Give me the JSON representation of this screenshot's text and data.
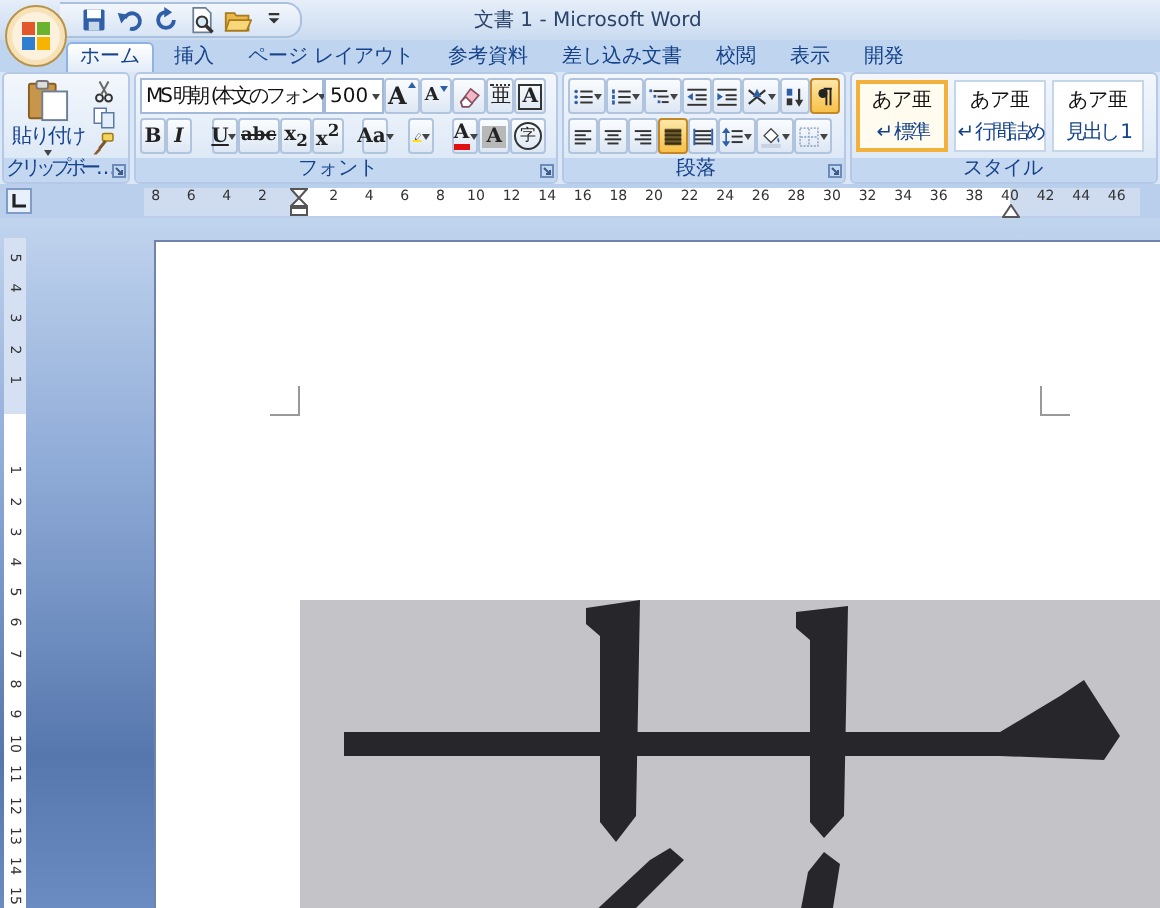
{
  "window": {
    "title": "文書 1 - Microsoft Word"
  },
  "quick_access": [
    {
      "kind": "save"
    },
    {
      "kind": "undo"
    },
    {
      "kind": "redo"
    },
    {
      "kind": "preview"
    },
    {
      "kind": "open"
    },
    {
      "kind": "customize"
    }
  ],
  "tabs": [
    {
      "label": "ホーム",
      "selected": true
    },
    {
      "label": "挿入",
      "selected": false
    },
    {
      "label": "ページ レイアウト",
      "selected": false
    },
    {
      "label": "参考資料",
      "selected": false
    },
    {
      "label": "差し込み文書",
      "selected": false
    },
    {
      "label": "校閲",
      "selected": false
    },
    {
      "label": "表示",
      "selected": false
    },
    {
      "label": "開発",
      "selected": false
    }
  ],
  "ribbon": {
    "clipboard": {
      "label": "クリップボー…",
      "paste": "貼り付け",
      "tools": [
        {
          "kind": "cut"
        },
        {
          "kind": "copy"
        },
        {
          "kind": "painter"
        }
      ]
    },
    "font": {
      "label": "フォント",
      "font_name": "MS 明朝 (本文のフォン",
      "font_size": "500",
      "top_buttons": [
        {
          "kind": "grow",
          "label": "A"
        },
        {
          "kind": "shrink",
          "label": "A"
        },
        {
          "kind": "clear"
        },
        {
          "kind": "ruby",
          "label": "亜"
        },
        {
          "kind": "border",
          "label": "A"
        }
      ],
      "bottom_buttons": [
        {
          "kind": "bold",
          "label": "B"
        },
        {
          "kind": "italic",
          "label": "I"
        },
        {
          "kind": "underline",
          "label": "U"
        },
        {
          "kind": "strike",
          "label": "abc"
        },
        {
          "kind": "sub",
          "label": "x$_{2}$"
        },
        {
          "kind": "sup",
          "label": "x$^{2}$"
        },
        {
          "kind": "case",
          "label": "Aa"
        },
        {
          "kind": "highlight"
        },
        {
          "kind": "color",
          "label": "A"
        },
        {
          "kind": "shading",
          "label": "A"
        },
        {
          "kind": "enclosed",
          "label": "字"
        }
      ]
    },
    "paragraph": {
      "label": "段落",
      "top_buttons": [
        {
          "kind": "bullets",
          "on": false
        },
        {
          "kind": "numbering",
          "on": false
        },
        {
          "kind": "multilevel",
          "on": false
        },
        {
          "kind": "outdent",
          "on": false
        },
        {
          "kind": "indent",
          "on": false
        },
        {
          "kind": "asian",
          "on": false
        },
        {
          "kind": "sort",
          "on": false
        },
        {
          "kind": "marks",
          "on": true
        }
      ],
      "bottom_buttons": [
        {
          "kind": "align_left",
          "on": false
        },
        {
          "kind": "center",
          "on": false
        },
        {
          "kind": "align_right",
          "on": false
        },
        {
          "kind": "justify",
          "on": true
        },
        {
          "kind": "distribute",
          "on": false
        },
        {
          "kind": "line_spacing",
          "on": false
        },
        {
          "kind": "fill",
          "on": false
        },
        {
          "kind": "borders",
          "on": false
        }
      ]
    },
    "styles": {
      "label": "スタイル",
      "items": [
        {
          "sample": "あア亜",
          "name": "↵ 標準",
          "selected": true
        },
        {
          "sample": "あア亜",
          "name": "↵ 行間詰め",
          "selected": false
        },
        {
          "sample": "あア亜",
          "name": "見出し 1",
          "selected": false
        }
      ]
    }
  },
  "horizontal_ruler": {
    "left_numbers": [
      "8",
      "6",
      "4",
      "2"
    ],
    "right_numbers": [
      "2",
      "4",
      "6",
      "8",
      "10",
      "12",
      "14",
      "16",
      "18",
      "20",
      "22",
      "24",
      "26",
      "28",
      "30",
      "32",
      "34",
      "36",
      "38",
      "40",
      "42",
      "44",
      "46"
    ]
  },
  "vertical_ruler": {
    "top_numbers": [
      "5",
      "4",
      "3",
      "2",
      "1"
    ],
    "body_numbers": [
      "1",
      "2",
      "3",
      "4",
      "5",
      "6",
      "7",
      "8",
      "9",
      "10",
      "11",
      "12",
      "13",
      "14",
      "15"
    ]
  }
}
